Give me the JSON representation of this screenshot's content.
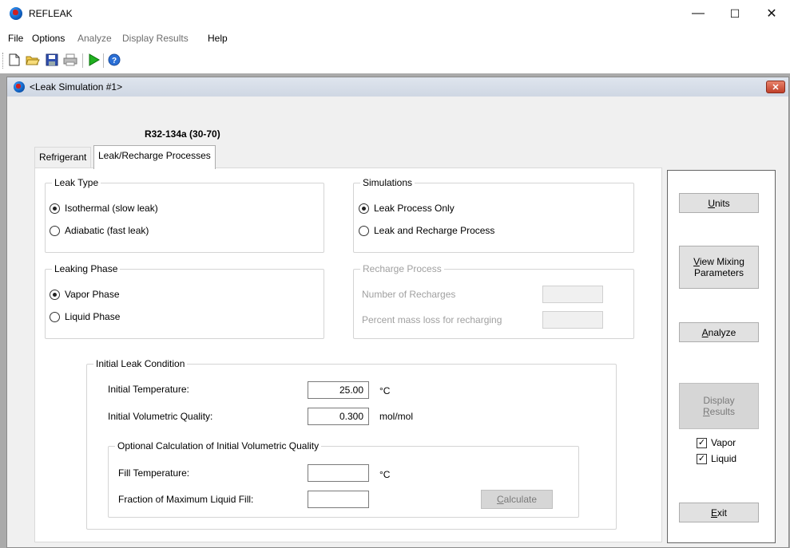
{
  "window": {
    "title": "REFLEAK",
    "controls": {
      "minimize": "—",
      "maximize": "☐",
      "close": "✕"
    }
  },
  "menu": [
    {
      "label": "File",
      "enabled": true
    },
    {
      "label": "Options",
      "enabled": true
    },
    {
      "label": "Analyze",
      "enabled": false
    },
    {
      "label": "Display Results",
      "enabled": false
    },
    {
      "label": "Help",
      "enabled": true
    }
  ],
  "toolbar": {
    "icons": [
      "new-file-icon",
      "open-folder-icon",
      "save-icon",
      "print-icon",
      "run-icon",
      "help-icon"
    ]
  },
  "child_window": {
    "title": "<Leak Simulation #1>",
    "close": "✕"
  },
  "mixture": "R32-134a (30-70)",
  "tabs": [
    {
      "label": "Refrigerant",
      "active": false
    },
    {
      "label": "Leak/Recharge Processes",
      "active": true
    }
  ],
  "leak_type": {
    "legend": "Leak Type",
    "options": [
      {
        "label": "Isothermal (slow leak)",
        "selected": true
      },
      {
        "label": "Adiabatic (fast leak)",
        "selected": false
      }
    ]
  },
  "simulations": {
    "legend": "Simulations",
    "options": [
      {
        "label": "Leak Process Only",
        "selected": true
      },
      {
        "label": "Leak and Recharge Process",
        "selected": false
      }
    ]
  },
  "leaking_phase": {
    "legend": "Leaking Phase",
    "options": [
      {
        "label": "Vapor Phase",
        "selected": true
      },
      {
        "label": "Liquid Phase",
        "selected": false
      }
    ]
  },
  "recharge": {
    "legend": "Recharge Process",
    "number_label": "Number of Recharges",
    "number_value": "",
    "percent_label": "Percent mass loss for recharging",
    "percent_value": ""
  },
  "initial_leak": {
    "legend": "Initial Leak Condition",
    "temperature_label": "Initial Temperature:",
    "temperature_value": "25.00",
    "temperature_unit": "°C",
    "quality_label": "Initial Volumetric Quality:",
    "quality_value": "0.300",
    "quality_unit": "mol/mol"
  },
  "optional_calc": {
    "legend": "Optional Calculation of Initial Volumetric Quality",
    "fill_temp_label": "Fill Temperature:",
    "fill_temp_value": "",
    "fill_temp_unit": "°C",
    "fraction_label": "Fraction of Maximum Liquid Fill:",
    "fraction_value": "",
    "calculate_pre": "",
    "calculate_key": "C",
    "calculate_post": "alculate"
  },
  "side": {
    "units_key": "U",
    "units_rest": "nits",
    "view_mix_key": "V",
    "view_mix_rest": "iew Mixing",
    "view_mix_line2": "Parameters",
    "analyze_key": "A",
    "analyze_rest": "nalyze",
    "display_line1": "Display",
    "display_key": "R",
    "display_rest": "esults",
    "vapor_label": "Vapor",
    "vapor_checked": true,
    "liquid_label": "Liquid",
    "liquid_checked": true,
    "exit_key": "E",
    "exit_rest": "xit"
  }
}
